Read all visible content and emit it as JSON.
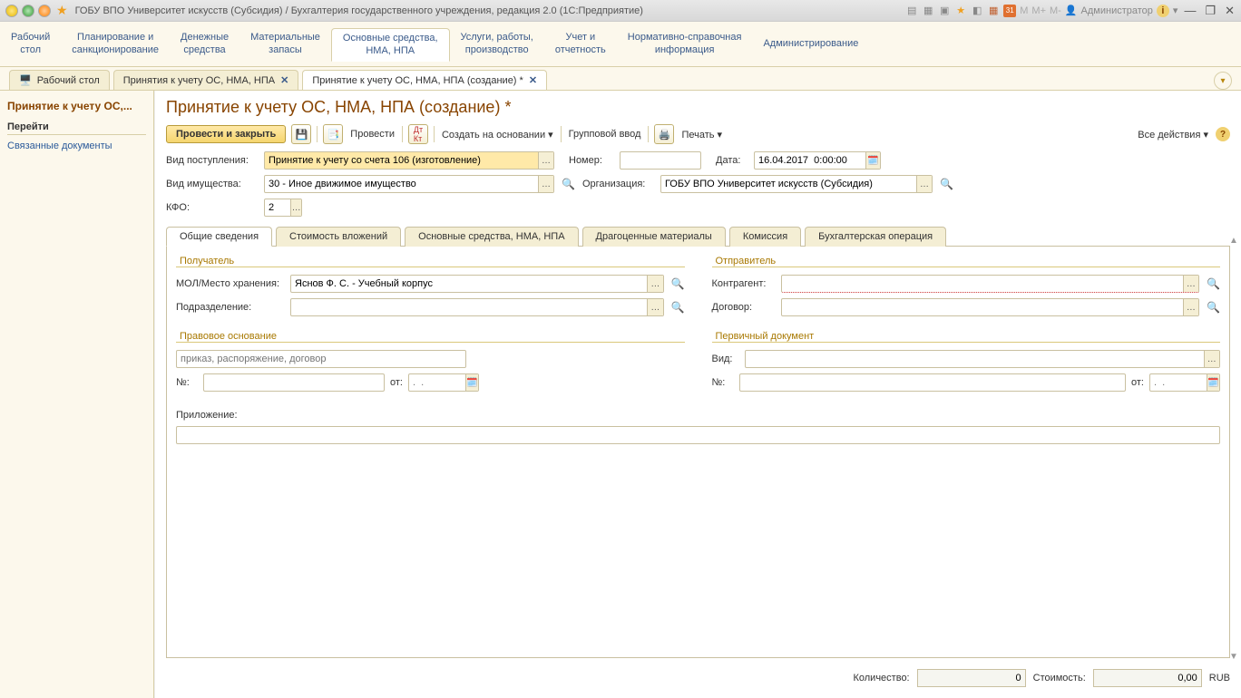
{
  "titlebar": {
    "app_title": "ГОБУ ВПО Университет искусств (Субсидия) / Бухгалтерия государственного учреждения, редакция 2.0  (1С:Предприятие)",
    "m_labels": [
      "M",
      "M+",
      "M-"
    ],
    "user_label": "Администратор",
    "cal_label": "31"
  },
  "sections": [
    "Рабочий\nстол",
    "Планирование и\nсанкционирование",
    "Денежные\nсредства",
    "Материальные\nзапасы",
    "Основные средства,\nНМА, НПА",
    "Услуги, работы,\nпроизводство",
    "Учет и\nотчетность",
    "Нормативно-справочная\nинформация",
    "Администрирование"
  ],
  "active_section_index": 4,
  "wtabs": [
    {
      "label": "Рабочий стол",
      "icon": "desktop"
    },
    {
      "label": "Принятия к учету ОС, НМА, НПА"
    },
    {
      "label": "Принятие к учету ОС, НМА, НПА (создание) *"
    }
  ],
  "active_wtab_index": 2,
  "sidebar": {
    "header": "Принятие к учету ОС,...",
    "sub": "Перейти",
    "links": [
      "Связанные документы"
    ]
  },
  "page": {
    "title": "Принятие к учету ОС, НМА, НПА (создание) *"
  },
  "toolbar": {
    "primary": "Провести и закрыть",
    "provesti": "Провести",
    "create_based": "Создать на основании",
    "group_input": "Групповой ввод",
    "print": "Печать",
    "all_actions": "Все действия"
  },
  "header_fields": {
    "vid_post_label": "Вид поступления:",
    "vid_post_value": "Принятие к учету со счета 106 (изготовление)",
    "number_label": "Номер:",
    "number_value": "",
    "date_label": "Дата:",
    "date_value": "16.04.2017  0:00:00",
    "vid_imush_label": "Вид имущества:",
    "vid_imush_value": "30 - Иное движимое имущество",
    "org_label": "Организация:",
    "org_value": "ГОБУ ВПО Университет искусств (Субсидия)",
    "kfo_label": "КФО:",
    "kfo_value": "2"
  },
  "tabs": [
    "Общие сведения",
    "Стоимость вложений",
    "Основные средства, НМА, НПА",
    "Драгоценные материалы",
    "Комиссия",
    "Бухгалтерская операция"
  ],
  "active_tab_index": 0,
  "common": {
    "recipient_legend": "Получатель",
    "sender_legend": "Отправитель",
    "mol_label": "МОЛ/Место хранения:",
    "mol_value": "Яснов Ф. С. - Учебный корпус",
    "podr_label": "Подразделение:",
    "podr_value": "",
    "contr_label": "Контрагент:",
    "contr_value": "",
    "dogovor_label": "Договор:",
    "dogovor_value": "",
    "legal_legend": "Правовое основание",
    "legal_placeholder": "приказ, распоряжение, договор",
    "legal_value": "",
    "no_label": "№:",
    "from_label": "от:",
    "date_placeholder": ".  .",
    "prim_legend": "Первичный документ",
    "vid_label": "Вид:",
    "vid_value": "",
    "pril_label": "Приложение:",
    "pril_value": ""
  },
  "footer": {
    "qty_label": "Количество:",
    "qty_value": "0",
    "cost_label": "Стоимость:",
    "cost_value": "0,00",
    "currency": "RUB"
  }
}
